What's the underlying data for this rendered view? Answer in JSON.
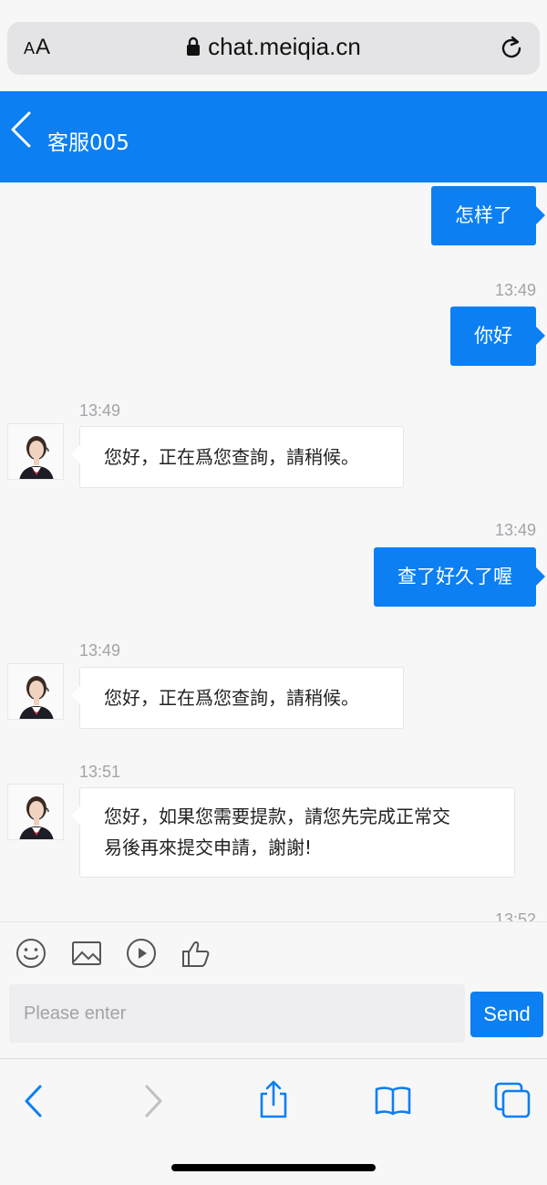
{
  "browser": {
    "text_size_label": "AA",
    "url": "chat.meiqia.cn"
  },
  "header": {
    "agent_name": "客服005"
  },
  "messages": [
    {
      "dir": "out",
      "text": "怎样了",
      "timestamp": ""
    },
    {
      "dir": "out",
      "text": "你好",
      "timestamp": "13:49"
    },
    {
      "dir": "in",
      "text": "您好，正在爲您查詢，請稍候。",
      "timestamp": "13:49"
    },
    {
      "dir": "out",
      "text": "查了好久了喔",
      "timestamp": "13:49"
    },
    {
      "dir": "in",
      "text": "您好，正在爲您查詢，請稍候。",
      "timestamp": "13:49"
    },
    {
      "dir": "in",
      "text_line1": "您好，如果您需要提款，請您先完成正常交",
      "text_line2": "易後再來提交申請，謝謝!",
      "timestamp": "13:51"
    },
    {
      "timestamp": "13:52"
    }
  ],
  "toolbar": {
    "icons": [
      "emoji-icon",
      "image-icon",
      "video-icon",
      "thumbs-up-icon"
    ]
  },
  "composer": {
    "placeholder": "Please enter",
    "value": "",
    "send_label": "Send"
  },
  "colors": {
    "accent": "#0c7ff2",
    "bubble_in": "#ffffff",
    "timestamp": "#a4a4a8"
  }
}
